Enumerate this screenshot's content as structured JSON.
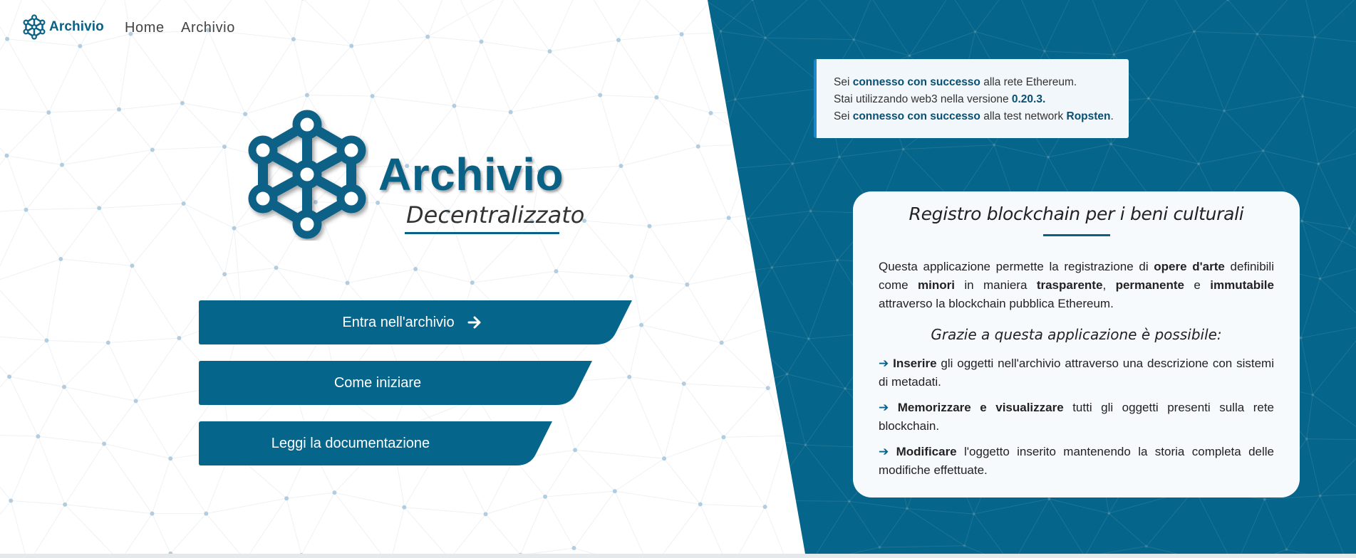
{
  "nav": {
    "brand": "Archivio",
    "links": [
      "Home",
      "Archivio"
    ]
  },
  "hero": {
    "title": "Archivio",
    "subtitle": "Decentralizzato"
  },
  "buttons": {
    "enter": "Entra nell'archivio",
    "start": "Come iniziare",
    "docs": "Leggi la documentazione"
  },
  "alert": {
    "line1": {
      "a": "Sei ",
      "b": "connesso con successo",
      "c": " alla rete Ethereum."
    },
    "line2": {
      "a": "Stai utilizzando web3 nella versione ",
      "b": "0.20.3."
    },
    "line3": {
      "a": "Sei ",
      "b": "connesso con successo",
      "c": " alla test network ",
      "d": "Ropsten",
      "e": "."
    }
  },
  "card": {
    "title": "Registro blockchain per i beni culturali",
    "intro": {
      "t1": "Questa applicazione permette la registrazione di ",
      "b1": "opere d'arte",
      "t2": " definibili come ",
      "b2": "minori",
      "t3": " in maniera ",
      "b3": "trasparente",
      "t4": ", ",
      "b4": "permanente",
      "t5": " e ",
      "b5": "immutabile",
      "t6": " attraverso la blockchain pubblica Ethereum."
    },
    "possible": "Grazie a questa applicazione è possibile:",
    "items": [
      {
        "bold": "Inserire",
        "text": " gli oggetti nell'archivio attraverso una descrizione con sistemi di metadati."
      },
      {
        "bold": "Memorizzare e visualizzare",
        "text": " tutti gli oggetti presenti sulla rete blockchain."
      },
      {
        "bold": "Modificare",
        "text": " l'oggetto inserito mantenendo la storia completa delle modifiche effettuate."
      }
    ]
  },
  "colors": {
    "primary": "#0a6186",
    "panel": "#05658a",
    "alert_border": "#1e88c8"
  },
  "icons": {
    "logo": "molecule-network-icon",
    "arrow": "arrow-right-icon"
  }
}
